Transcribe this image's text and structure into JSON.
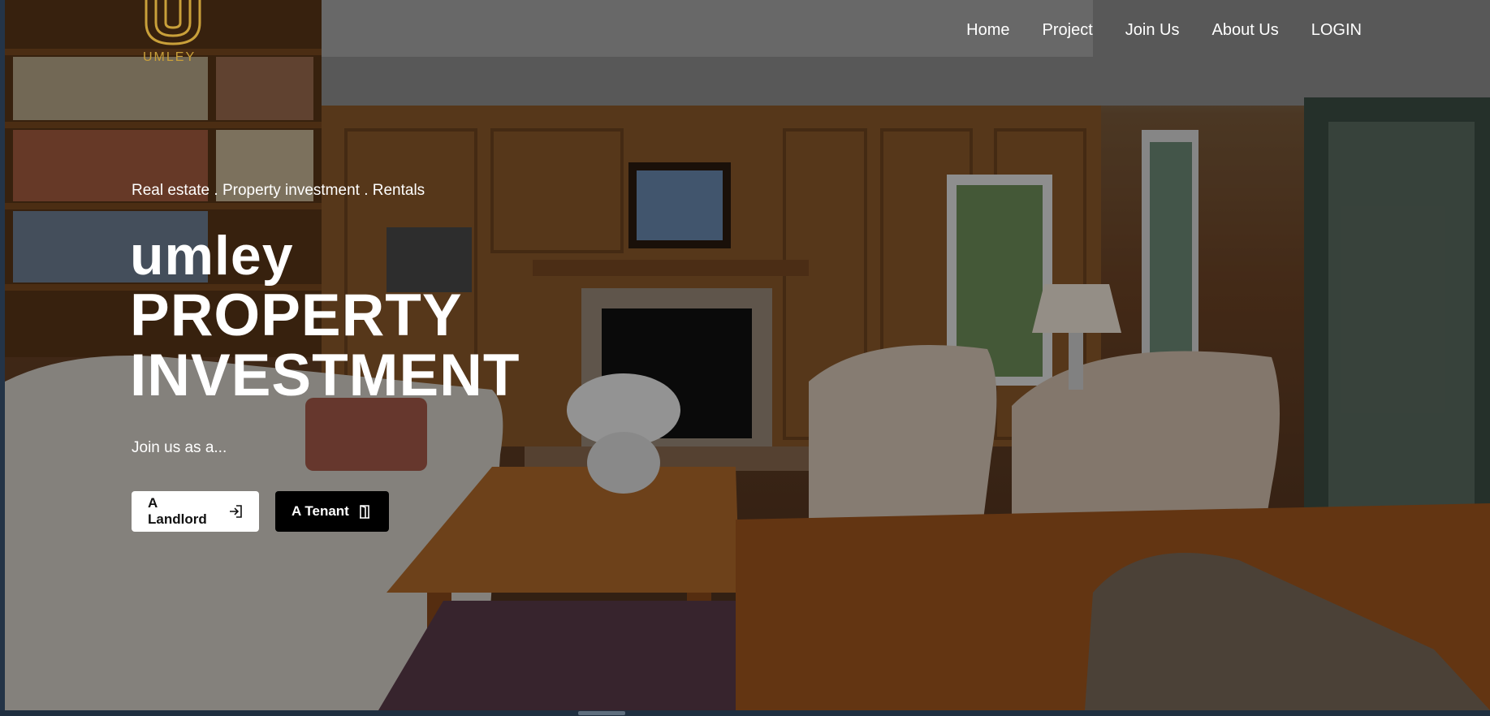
{
  "brand": {
    "name": "UMLEY",
    "color": "#c9a03a"
  },
  "nav": {
    "items": [
      {
        "label": "Home"
      },
      {
        "label": "Project"
      },
      {
        "label": "Join Us"
      },
      {
        "label": "About Us"
      },
      {
        "label": "LOGIN"
      }
    ]
  },
  "hero": {
    "tagline": "Real estate . Property investment . Rentals",
    "title_line1": "umley",
    "title_line2": "PROPERTY",
    "title_line3": "INVESTMENT",
    "join_text": "Join us as a...",
    "landlord_button": {
      "label": "A Landlord",
      "icon": "login-icon"
    },
    "tenant_button": {
      "label": "A Tenant",
      "icon": "door-icon"
    }
  }
}
